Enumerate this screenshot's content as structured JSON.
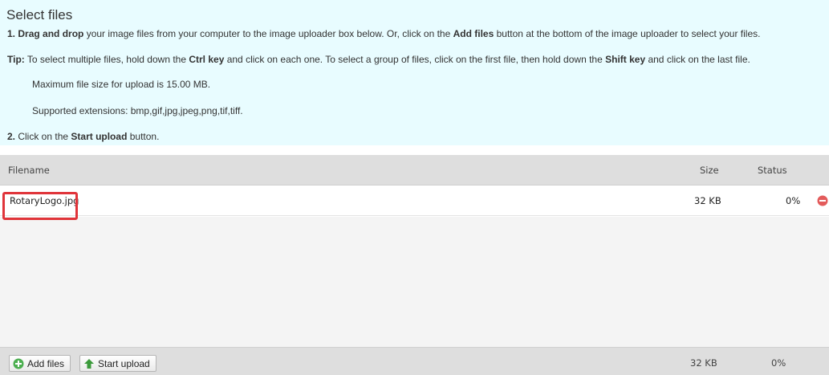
{
  "instructions": {
    "title": "Select files",
    "step1": {
      "num": "1.",
      "bold1": "Drag and drop",
      "text1": " your image files from your computer to the image uploader box below. Or, click on the ",
      "bold2": "Add files",
      "text2": " button at the bottom of the image uploader to select your files."
    },
    "tip": {
      "label": "Tip:",
      "text1": " To select multiple files, hold down the ",
      "bold1": "Ctrl key",
      "text2": " and click on each one. To select a group of files, click on the first file, then hold down the ",
      "bold2": "Shift key",
      "text3": " and click on the last file."
    },
    "max_size": "Maximum file size for upload is 15.00 MB.",
    "extensions": "Supported extensions: bmp,gif,jpg,jpeg,png,tif,tiff.",
    "step2": {
      "num": "2.",
      "text1": " Click on the ",
      "bold1": "Start upload",
      "text2": " button."
    }
  },
  "table": {
    "headers": {
      "filename": "Filename",
      "size": "Size",
      "status": "Status"
    },
    "rows": [
      {
        "filename": "RotaryLogo.jpg",
        "size": "32 KB",
        "status": "0%"
      }
    ]
  },
  "footer": {
    "add_files_label": "Add files",
    "start_upload_label": "Start upload",
    "total_size": "32 KB",
    "total_status": "0%"
  },
  "colors": {
    "instructions_bg": "#e8fcff",
    "highlight": "#e0343a",
    "add_icon": "#4caf50",
    "upload_icon": "#3b9a3b",
    "remove_icon": "#e35b5b"
  },
  "icons": {
    "add": "plus-circle-icon",
    "upload": "arrow-up-icon",
    "remove": "minus-circle-icon"
  }
}
